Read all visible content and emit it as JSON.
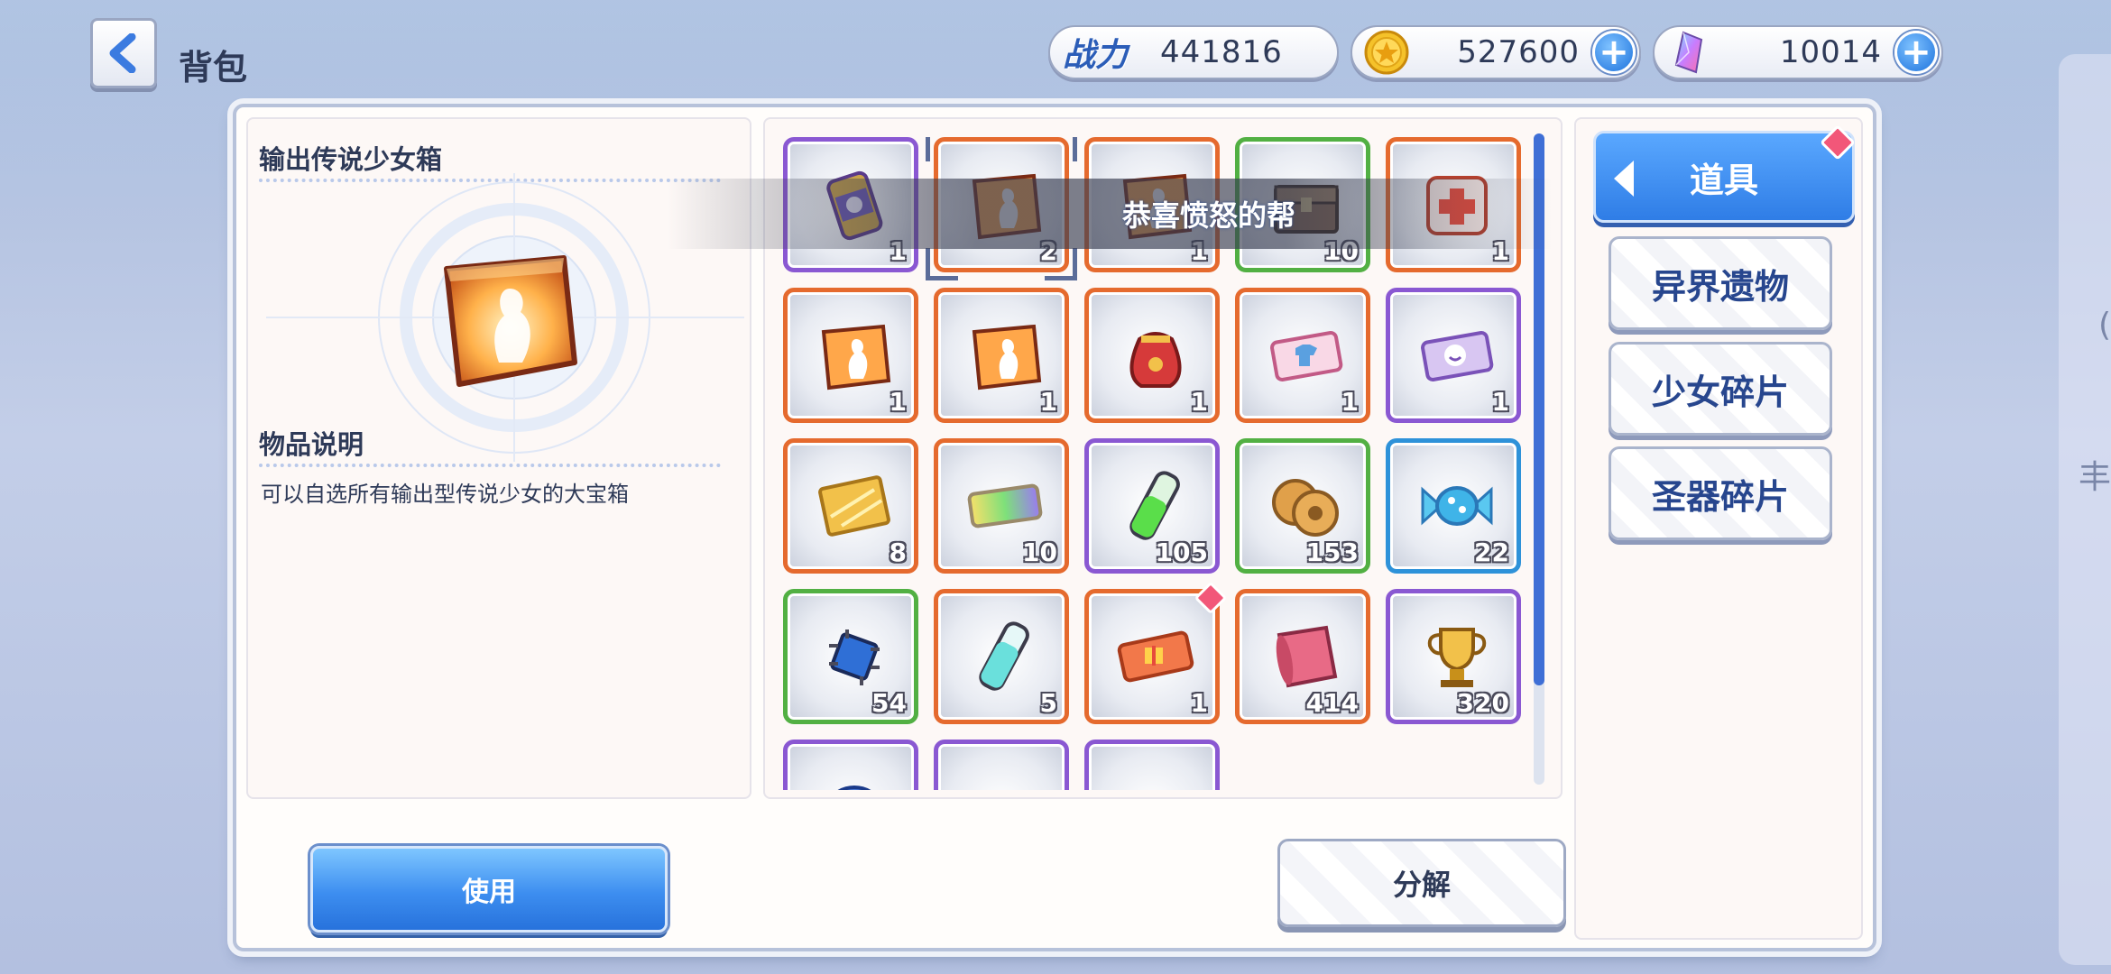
{
  "header": {
    "title": "背包",
    "power_label": "战力",
    "power_value": "441816",
    "gold_value": "527600",
    "gem_value": "10014"
  },
  "detail": {
    "item_name": "输出传说少女箱",
    "desc_title": "物品说明",
    "desc_text": "可以自选所有输出型传说少女的大宝箱"
  },
  "toast": "恭喜愤怒的帮",
  "buttons": {
    "use": "使用",
    "decompose": "分解"
  },
  "tabs": [
    {
      "label": "道具",
      "active": true
    },
    {
      "label": "异界遗物",
      "active": false
    },
    {
      "label": "少女碎片",
      "active": false
    },
    {
      "label": "圣器碎片",
      "active": false
    }
  ],
  "items": [
    {
      "icon": "can-icon",
      "rarity": "purple",
      "count": "1"
    },
    {
      "icon": "legend-box-icon",
      "rarity": "orange",
      "count": "2",
      "selected": true
    },
    {
      "icon": "legend-box-icon",
      "rarity": "orange",
      "count": "1"
    },
    {
      "icon": "treasure-chest-icon",
      "rarity": "green",
      "count": "10"
    },
    {
      "icon": "medkit-box-icon",
      "rarity": "orange",
      "count": "1"
    },
    {
      "icon": "legend-box-icon",
      "rarity": "orange",
      "count": "1"
    },
    {
      "icon": "legend-box-icon",
      "rarity": "orange",
      "count": "1"
    },
    {
      "icon": "lucky-bag-icon",
      "rarity": "orange",
      "count": "1"
    },
    {
      "icon": "outfit-ticket-icon",
      "rarity": "orange",
      "count": "1"
    },
    {
      "icon": "face-ticket-icon",
      "rarity": "purple",
      "count": "1"
    },
    {
      "icon": "gold-card-icon",
      "rarity": "orange",
      "count": "8"
    },
    {
      "icon": "rainbow-ticket-icon",
      "rarity": "orange",
      "count": "10"
    },
    {
      "icon": "green-potion-icon",
      "rarity": "purple",
      "count": "105"
    },
    {
      "icon": "cookie-icon",
      "rarity": "green",
      "count": "153"
    },
    {
      "icon": "candy-icon",
      "rarity": "blue",
      "count": "22"
    },
    {
      "icon": "chip-icon",
      "rarity": "green",
      "count": "54"
    },
    {
      "icon": "cyan-potion-icon",
      "rarity": "orange",
      "count": "5"
    },
    {
      "icon": "gift-ticket-icon",
      "rarity": "orange",
      "count": "1",
      "badge": true
    },
    {
      "icon": "scroll-icon",
      "rarity": "orange",
      "count": "414"
    },
    {
      "icon": "trophy-icon",
      "rarity": "purple",
      "count": "320"
    },
    {
      "icon": "coin-icon",
      "rarity": "purple",
      "count": ""
    },
    {
      "icon": "box-icon",
      "rarity": "purple",
      "count": ""
    },
    {
      "icon": "crystal-icon",
      "rarity": "purple",
      "count": ""
    }
  ],
  "colors": {
    "orange": "#e56a2e",
    "purple": "#8a58d2",
    "green": "#52b043",
    "blue": "#2e92d9",
    "accent": "#2f7de6",
    "badge": "#f25779"
  }
}
